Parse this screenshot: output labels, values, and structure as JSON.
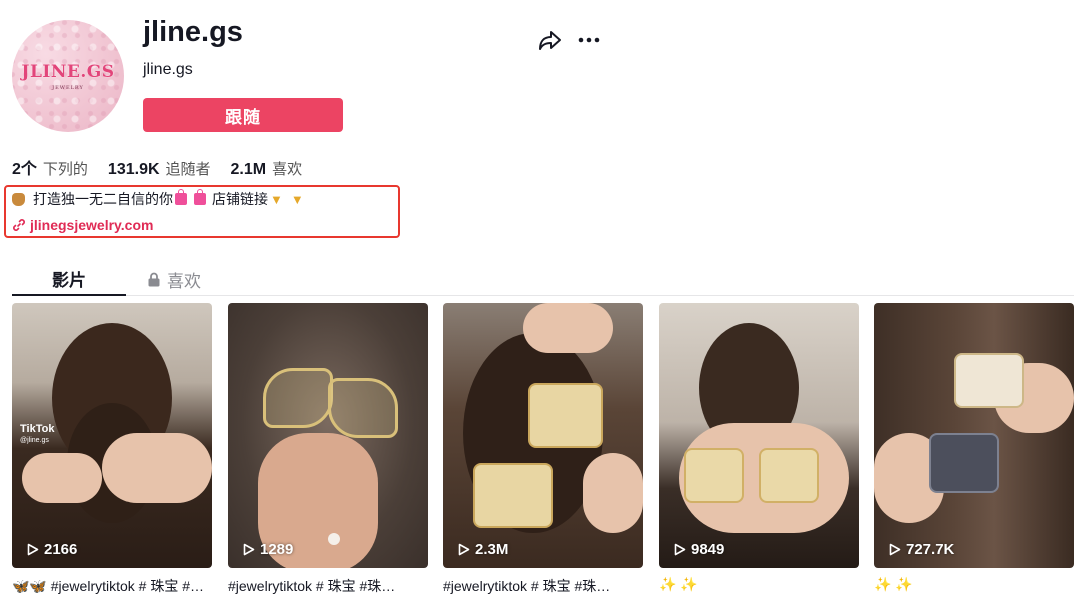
{
  "profile": {
    "avatar_logo": "JLINE.GS",
    "avatar_sub": "JEWELRY",
    "username": "jline.gs",
    "nickname": "jline.gs",
    "follow_label": "跟随"
  },
  "stats": [
    {
      "value": "2个",
      "label": "下列的"
    },
    {
      "value": "131.9K",
      "label": "追随者"
    },
    {
      "value": "2.1M",
      "label": "喜欢"
    }
  ],
  "bio": {
    "text_part1": "打造独一无二自信的你",
    "text_part2": "店铺链接",
    "link": "jlinegsjewelry.com"
  },
  "tabs": {
    "videos": "影片",
    "liked": "喜欢"
  },
  "videos": [
    {
      "views": "2166",
      "caption": "🦋🦋 #jewelrytiktok # 珠宝 #…",
      "watermark": "TikTok",
      "watermark_handle": "@jline.gs"
    },
    {
      "views": "1289",
      "caption": "#jewelrytiktok # 珠宝 #珠…"
    },
    {
      "views": "2.3M",
      "caption": "#jewelrytiktok # 珠宝 #珠…"
    },
    {
      "views": "9849",
      "caption": "✨ ✨"
    },
    {
      "views": "727.7K",
      "caption": "✨ ✨"
    }
  ],
  "colors": {
    "accent": "#ec4463",
    "link": "#e02b55",
    "highlight_box": "#e8382f",
    "text": "#161823",
    "muted": "#8a8b91"
  },
  "icons": [
    "share-icon",
    "more-icon",
    "link-icon",
    "lock-icon",
    "play-icon"
  ]
}
